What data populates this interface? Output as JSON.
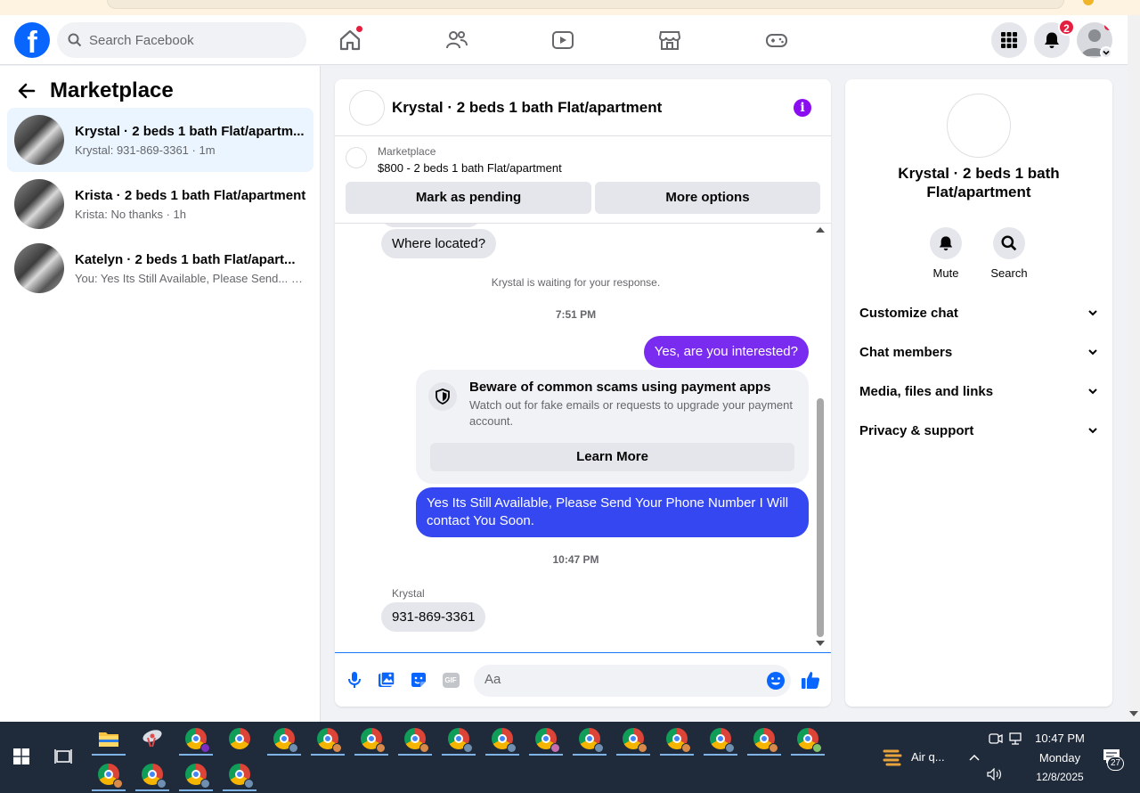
{
  "search": {
    "placeholder": "Search Facebook"
  },
  "notifications": {
    "count": "2"
  },
  "left": {
    "title": "Marketplace",
    "conversations": [
      {
        "name": "Krystal · 2 beds 1 bath Flat/apartm...",
        "snippet": "Krystal: 931-869-3361 · 1m"
      },
      {
        "name": "Krista · 2 beds 1 bath Flat/apartment",
        "snippet": "Krista: No thanks · 1h"
      },
      {
        "name": "Katelyn · 2 beds 1 bath Flat/apart...",
        "snippet": "You: Yes Its Still Available, Please Send... · 2h"
      }
    ]
  },
  "chat": {
    "title": "Krystal · 2 beds 1 bath Flat/apartment",
    "marketplace_label": "Marketplace",
    "listing": "$800 - 2 beds 1 bath Flat/apartment",
    "mark_pending": "Mark as pending",
    "more_options": "More options",
    "messages": {
      "where_located": "Where located?",
      "waiting": "Krystal is waiting for your response.",
      "time1": "7:51 PM",
      "interested": "Yes, are you interested?",
      "scam_title": "Beware of common scams using payment apps",
      "scam_body": "Watch out for fake emails or requests to upgrade your payment account.",
      "learn_more": "Learn More",
      "still_available": "Yes Its Still Available, Please Send Your Phone Number I Will contact You Soon.",
      "time2": "10:47 PM",
      "sender": "Krystal",
      "phone": "931-869-3361"
    },
    "composer_placeholder": "Aa",
    "gif_label": "GIF"
  },
  "right": {
    "name": "Krystal · 2 beds 1 bath Flat/apartment",
    "mute": "Mute",
    "search": "Search",
    "rows": [
      "Customize chat",
      "Chat members",
      "Media, files and links",
      "Privacy & support"
    ]
  },
  "taskbar": {
    "weather": "Air q...",
    "time": "10:47 PM",
    "day": "Monday",
    "date": "12/8/2025",
    "notif_count": "27"
  },
  "colors": {
    "fb_blue": "#0866ff",
    "purple_bubble": "#7a2bf0",
    "blue_bubble": "#3447f0",
    "info_purple": "#8a0cf0"
  }
}
